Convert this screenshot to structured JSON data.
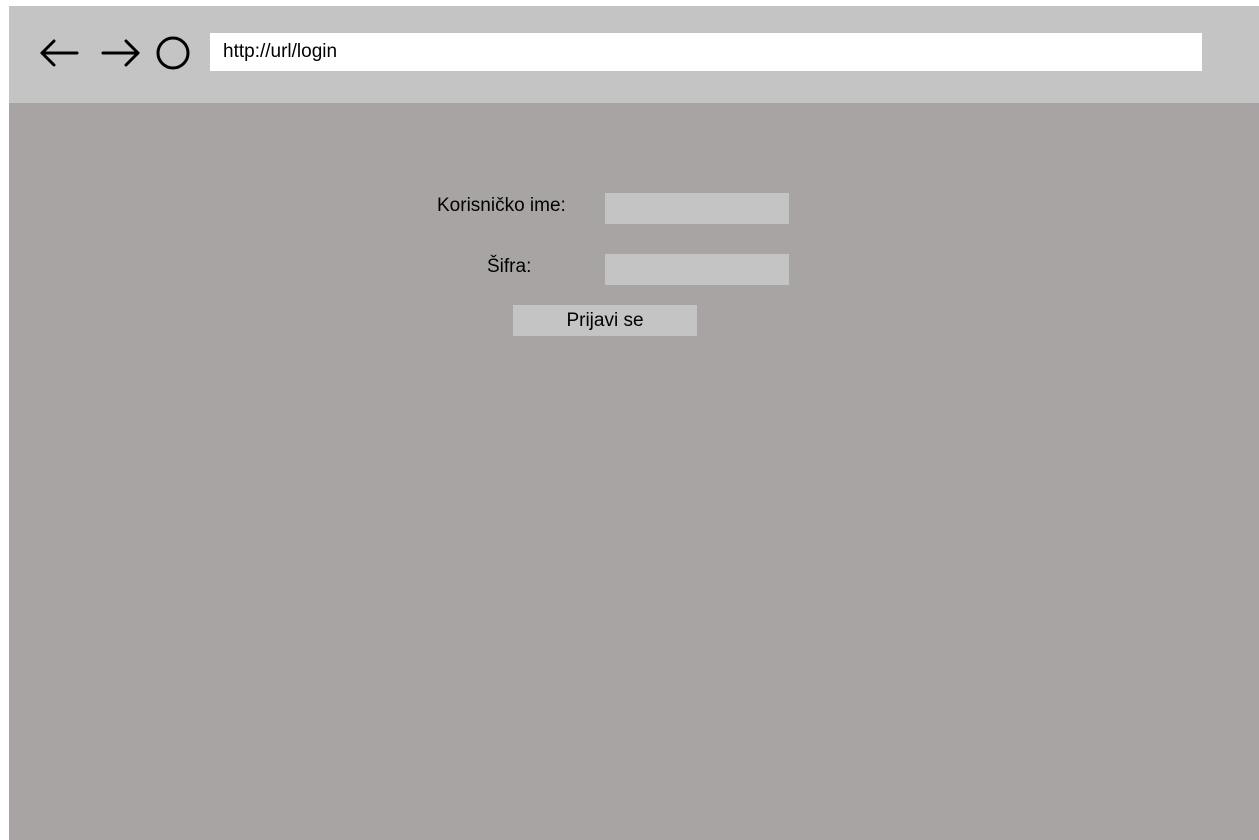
{
  "browser": {
    "url": "http://url/login",
    "back_icon": "arrow-left-icon",
    "forward_icon": "arrow-right-icon",
    "reload_icon": "reload-circle-icon"
  },
  "login_form": {
    "username_label": "Korisničko ime:",
    "username_value": "",
    "password_label": "Šifra:",
    "password_value": "",
    "submit_label": "Prijavi se"
  },
  "colors": {
    "toolbar": "#c4c4c4",
    "page_background": "#a8a4a3",
    "field_background": "#c4c4c4",
    "url_bar_background": "#ffffff"
  }
}
